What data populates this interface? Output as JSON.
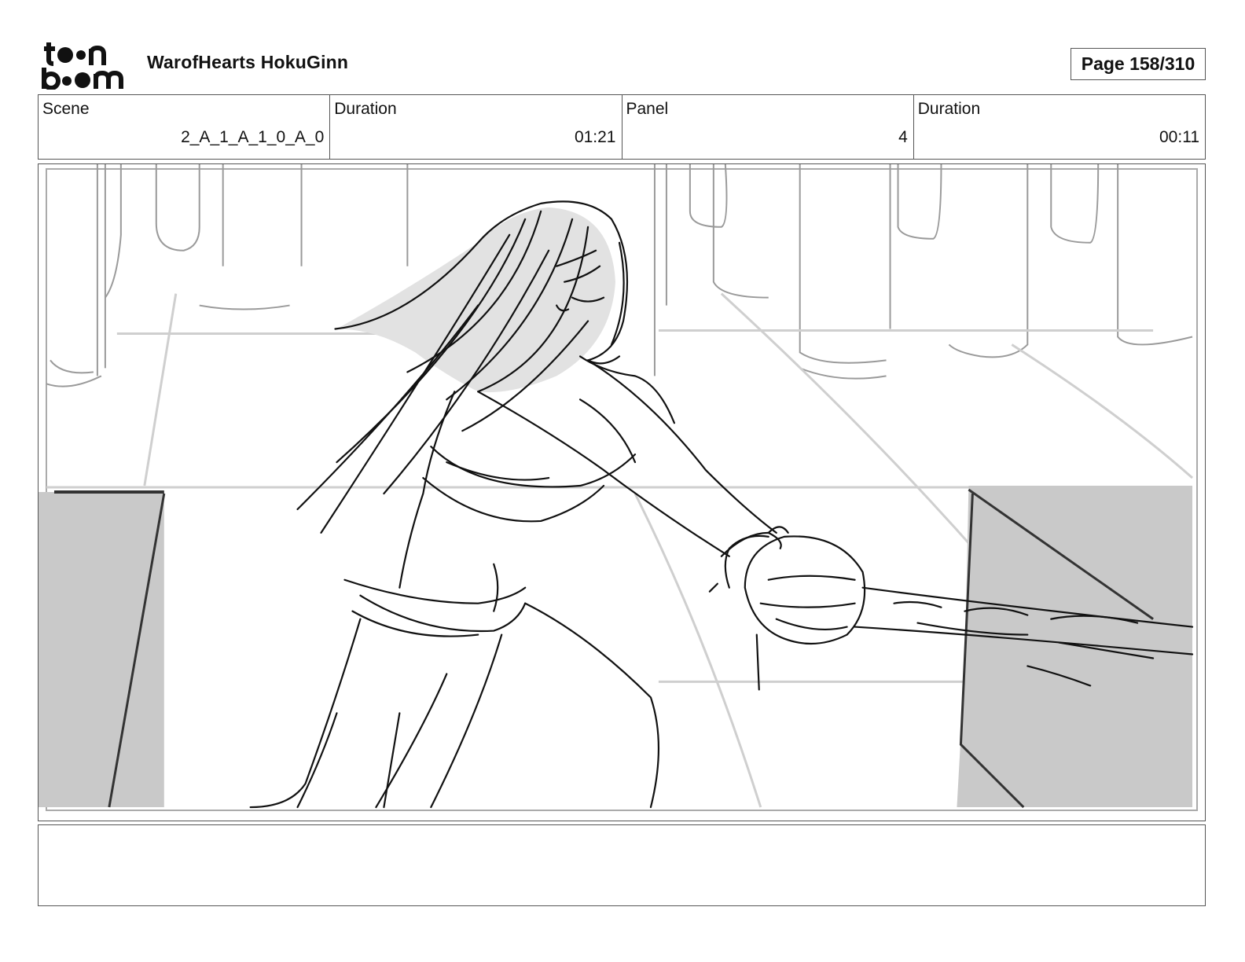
{
  "header": {
    "logo_text": "toon boom",
    "project_title": "WarofHearts HokuGinn",
    "page_indicator": "Page 158/310"
  },
  "info_bar": {
    "scene_label": "Scene",
    "scene_value": "2_A_1_A_1_0_A_0",
    "scene_duration_label": "Duration",
    "scene_duration_value": "01:21",
    "panel_label": "Panel",
    "panel_value": "4",
    "panel_duration_label": "Duration",
    "panel_duration_value": "00:11"
  },
  "notes": {
    "text": ""
  },
  "colors": {
    "sketch_line": "#111111",
    "background_line": "#9a9a9a",
    "block_fill": "#c9c9c9",
    "hair_fill": "#e2e2e2",
    "frame_border": "#555555"
  }
}
